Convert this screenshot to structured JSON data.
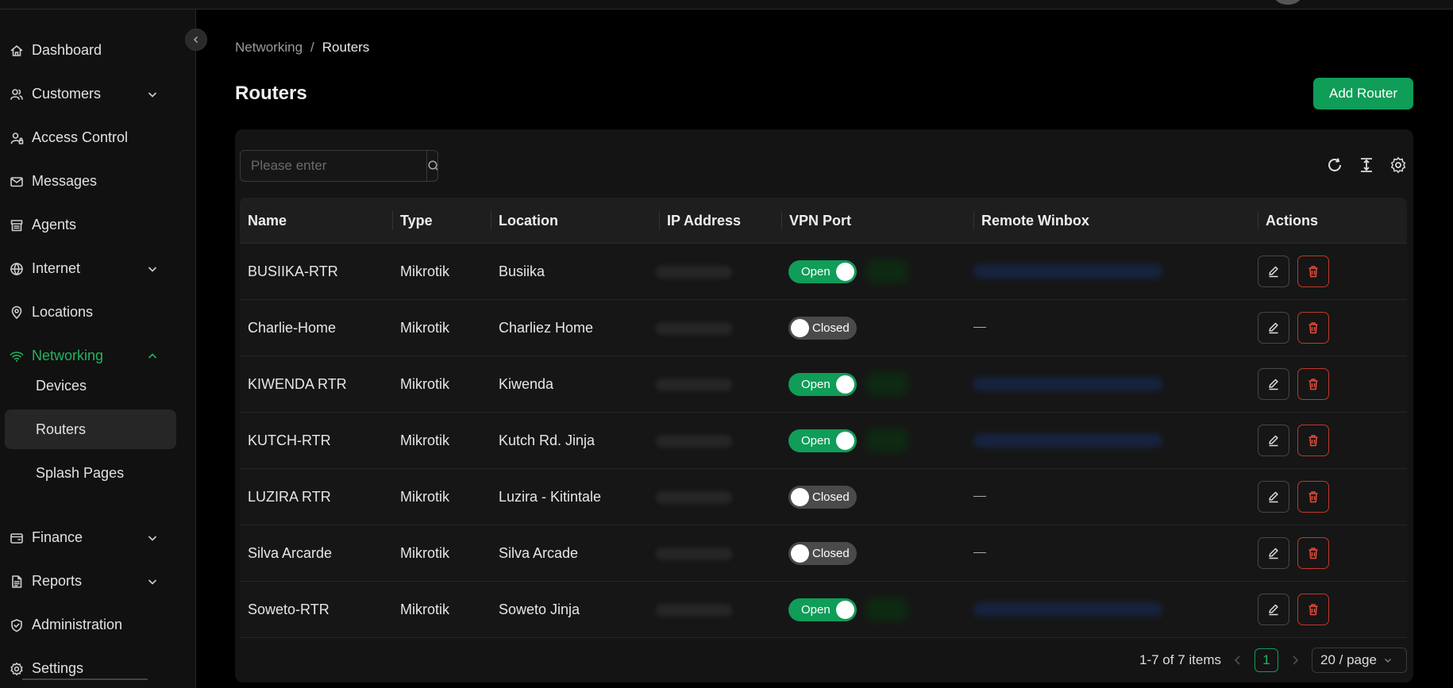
{
  "sidebar": {
    "items": [
      {
        "label": "Dashboard",
        "icon": "home-icon"
      },
      {
        "label": "Customers",
        "icon": "users-icon",
        "expandable": true
      },
      {
        "label": "Access Control",
        "icon": "user-lock-icon"
      },
      {
        "label": "Messages",
        "icon": "mail-icon"
      },
      {
        "label": "Agents",
        "icon": "store-icon"
      },
      {
        "label": "Internet",
        "icon": "globe-icon",
        "expandable": true
      },
      {
        "label": "Locations",
        "icon": "map-pin-icon"
      },
      {
        "label": "Networking",
        "icon": "wifi-icon",
        "expandable": true,
        "expanded": true,
        "active": true
      },
      {
        "label": "Finance",
        "icon": "wallet-icon",
        "expandable": true
      },
      {
        "label": "Reports",
        "icon": "report-icon",
        "expandable": true
      },
      {
        "label": "Administration",
        "icon": "shield-icon"
      },
      {
        "label": "Settings",
        "icon": "gear-icon"
      }
    ],
    "networking_sub": [
      {
        "label": "Devices"
      },
      {
        "label": "Routers",
        "selected": true
      },
      {
        "label": "Splash Pages"
      }
    ]
  },
  "breadcrumb": {
    "parent": "Networking",
    "separator": "/",
    "current": "Routers"
  },
  "page": {
    "title": "Routers",
    "add_button": "Add Router"
  },
  "search": {
    "placeholder": "Please enter",
    "value": ""
  },
  "table": {
    "columns": [
      "Name",
      "Type",
      "Location",
      "IP Address",
      "VPN Port",
      "Remote Winbox",
      "Actions"
    ],
    "rows": [
      {
        "name": "BUSIIKA-RTR",
        "type": "Mikrotik",
        "location": "Busiika",
        "vpn": "Open",
        "remote": "blurred"
      },
      {
        "name": "Charlie-Home",
        "type": "Mikrotik",
        "location": "Charliez Home",
        "vpn": "Closed",
        "remote": "—"
      },
      {
        "name": "KIWENDA RTR",
        "type": "Mikrotik",
        "location": "Kiwenda",
        "vpn": "Open",
        "remote": "blurred"
      },
      {
        "name": "KUTCH-RTR",
        "type": "Mikrotik",
        "location": "Kutch Rd. Jinja",
        "vpn": "Open",
        "remote": "blurred"
      },
      {
        "name": "LUZIRA RTR",
        "type": "Mikrotik",
        "location": "Luzira - Kitintale",
        "vpn": "Closed",
        "remote": "—"
      },
      {
        "name": "Silva Arcarde",
        "type": "Mikrotik",
        "location": "Silva Arcade",
        "vpn": "Closed",
        "remote": "—"
      },
      {
        "name": "Soweto-RTR",
        "type": "Mikrotik",
        "location": "Soweto Jinja",
        "vpn": "Open",
        "remote": "blurred"
      }
    ]
  },
  "pagination": {
    "summary": "1-7 of 7 items",
    "current_page": "1",
    "page_size": "20 / page"
  },
  "colors": {
    "accent": "#0f9d58",
    "danger": "#c0392b",
    "background": "#000000",
    "sidebar": "#111111"
  }
}
